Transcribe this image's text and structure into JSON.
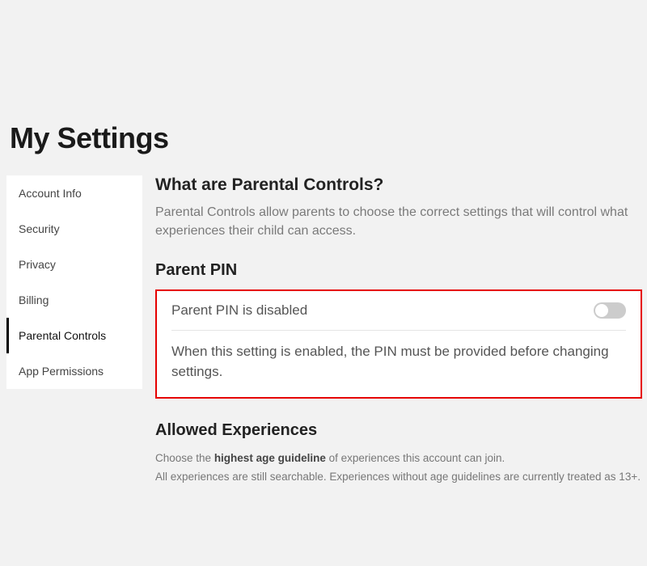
{
  "page_title": "My Settings",
  "sidebar": {
    "items": [
      {
        "label": "Account Info",
        "active": false
      },
      {
        "label": "Security",
        "active": false
      },
      {
        "label": "Privacy",
        "active": false
      },
      {
        "label": "Billing",
        "active": false
      },
      {
        "label": "Parental Controls",
        "active": true
      },
      {
        "label": "App Permissions",
        "active": false
      }
    ]
  },
  "content": {
    "intro_heading": "What are Parental Controls?",
    "intro_text": "Parental Controls allow parents to choose the correct settings that will control what experiences their child can access.",
    "parent_pin": {
      "heading": "Parent PIN",
      "status_label": "Parent PIN is disabled",
      "toggle_on": false,
      "description": "When this setting is enabled, the PIN must be provided before changing settings."
    },
    "allowed_experiences": {
      "heading": "Allowed Experiences",
      "line1_pre": "Choose the ",
      "line1_bold": "highest age guideline",
      "line1_post": " of experiences this account can join.",
      "line2": "All experiences are still searchable. Experiences without age guidelines are currently treated as 13+."
    }
  }
}
